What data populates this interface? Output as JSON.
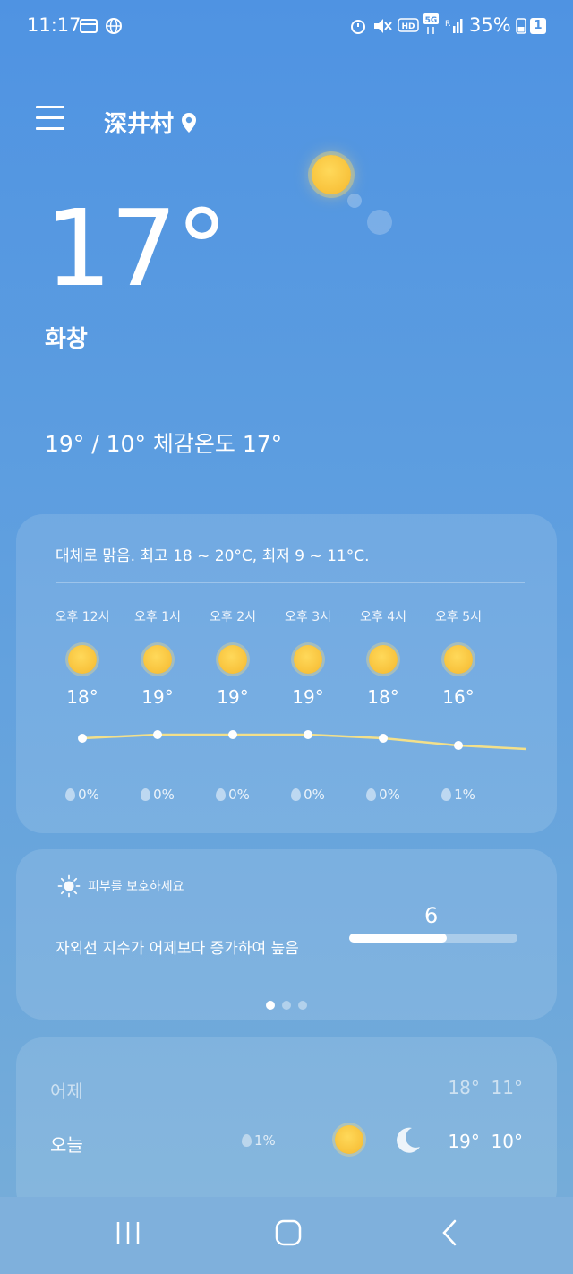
{
  "status_bar": {
    "time": "11:17",
    "battery_percent": "35%",
    "sim_badge": "1",
    "network": "5G"
  },
  "header": {
    "location": "深井村"
  },
  "current": {
    "temperature": "17°",
    "condition": "화창",
    "minmax_feels": "19° / 10° 체감온도 17°"
  },
  "hourly": {
    "summary": "대체로 맑음. 최고 18 ~ 20°C, 최저 9 ~ 11°C.",
    "items": [
      {
        "time": "오후 12시",
        "temp": "18°",
        "rain": "0%",
        "icon": "sun-icon"
      },
      {
        "time": "오후 1시",
        "temp": "19°",
        "rain": "0%",
        "icon": "sun-icon"
      },
      {
        "time": "오후 2시",
        "temp": "19°",
        "rain": "0%",
        "icon": "sun-icon"
      },
      {
        "time": "오후 3시",
        "temp": "19°",
        "rain": "0%",
        "icon": "sun-icon"
      },
      {
        "time": "오후 4시",
        "temp": "18°",
        "rain": "0%",
        "icon": "sun-icon"
      },
      {
        "time": "오후 5시",
        "temp": "16°",
        "rain": "1%",
        "icon": "sun-icon"
      }
    ],
    "line_temps": [
      18,
      19,
      19,
      19,
      18,
      16,
      15
    ]
  },
  "uv": {
    "header": "피부를 보호하세요",
    "description": "자외선 지수가 어제보다 증가하여 높음",
    "value": "6",
    "level_fraction": 0.58
  },
  "daily": {
    "rows": [
      {
        "day": "어제",
        "high": "18°",
        "low": "11°"
      },
      {
        "day": "오늘",
        "rain": "1%",
        "high": "19°",
        "low": "10°"
      }
    ]
  },
  "colors": {
    "background_top": "#4f93e2",
    "background_bottom": "#78aed8",
    "sun": "#f5b82e",
    "temp_line": "#f3e08a"
  }
}
